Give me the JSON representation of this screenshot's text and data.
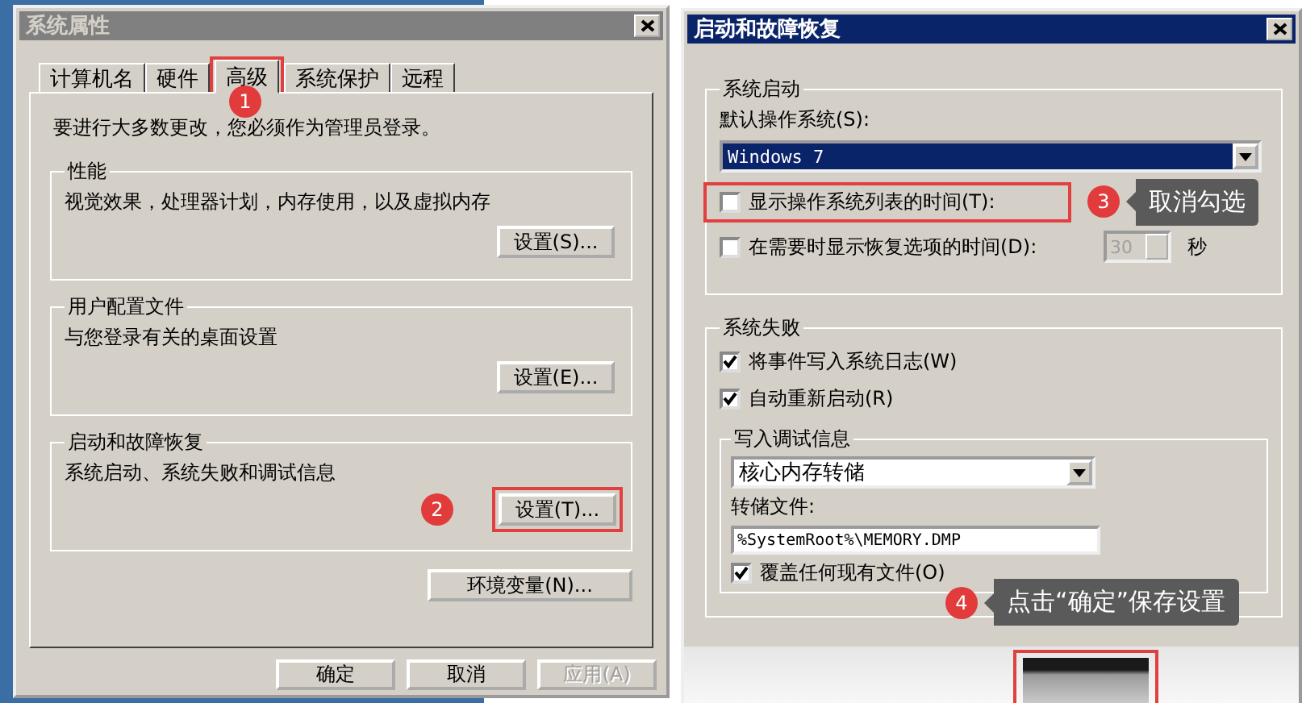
{
  "system_properties": {
    "title": "系统属性",
    "active": false,
    "tabs": [
      {
        "label": "计算机名",
        "selected": false,
        "highlighted": false
      },
      {
        "label": "硬件",
        "selected": false,
        "highlighted": false
      },
      {
        "label": "高级",
        "selected": true,
        "highlighted": true,
        "step": "1"
      },
      {
        "label": "系统保护",
        "selected": false,
        "highlighted": false
      },
      {
        "label": "远程",
        "selected": false,
        "highlighted": false
      }
    ],
    "notice": "要进行大多数更改，您必须作为管理员登录。",
    "groups": [
      {
        "title": "性能",
        "description": "视觉效果，处理器计划，内存使用，以及虚拟内存",
        "button": {
          "label": "设置(S)...",
          "highlighted": false
        }
      },
      {
        "title": "用户配置文件",
        "description": "与您登录有关的桌面设置",
        "button": {
          "label": "设置(E)...",
          "highlighted": false
        }
      },
      {
        "title": "启动和故障恢复",
        "description": "系统启动、系统失败和调试信息",
        "button": {
          "label": "设置(T)...",
          "highlighted": true,
          "step": "2"
        }
      }
    ],
    "env_button": "环境变量(N)...",
    "buttons": [
      {
        "label": "确定",
        "disabled": false
      },
      {
        "label": "取消",
        "disabled": false
      },
      {
        "label": "应用(A)",
        "disabled": true
      }
    ]
  },
  "startup_recovery": {
    "title": "启动和故障恢复",
    "active": true,
    "system_startup": {
      "title": "系统启动",
      "default_os_label": "默认操作系统(S):",
      "default_os": "Windows 7",
      "options": [
        {
          "label": "显示操作系统列表的时间(T):",
          "checked": false,
          "highlighted": true,
          "step": "3",
          "tip": "取消勾选"
        },
        {
          "label": "在需要时显示恢复选项的时间(D):",
          "checked": false,
          "highlighted": false,
          "seconds": "30",
          "unit": "秒"
        }
      ]
    },
    "system_failure": {
      "title": "系统失败",
      "options": [
        {
          "label": "将事件写入系统日志(W)",
          "checked": true
        },
        {
          "label": "自动重新启动(R)",
          "checked": true
        }
      ],
      "debug_info": {
        "title": "写入调试信息",
        "dump_type": "核心内存转储",
        "dump_file_label": "转储文件:",
        "dump_file": "%SystemRoot%\\MEMORY.DMP",
        "overwrite": {
          "label": "覆盖任何现有文件(O)",
          "checked": true
        }
      }
    },
    "footer": {
      "step": "4",
      "tip": "点击“确定”保存设置",
      "highlighted": true
    }
  }
}
